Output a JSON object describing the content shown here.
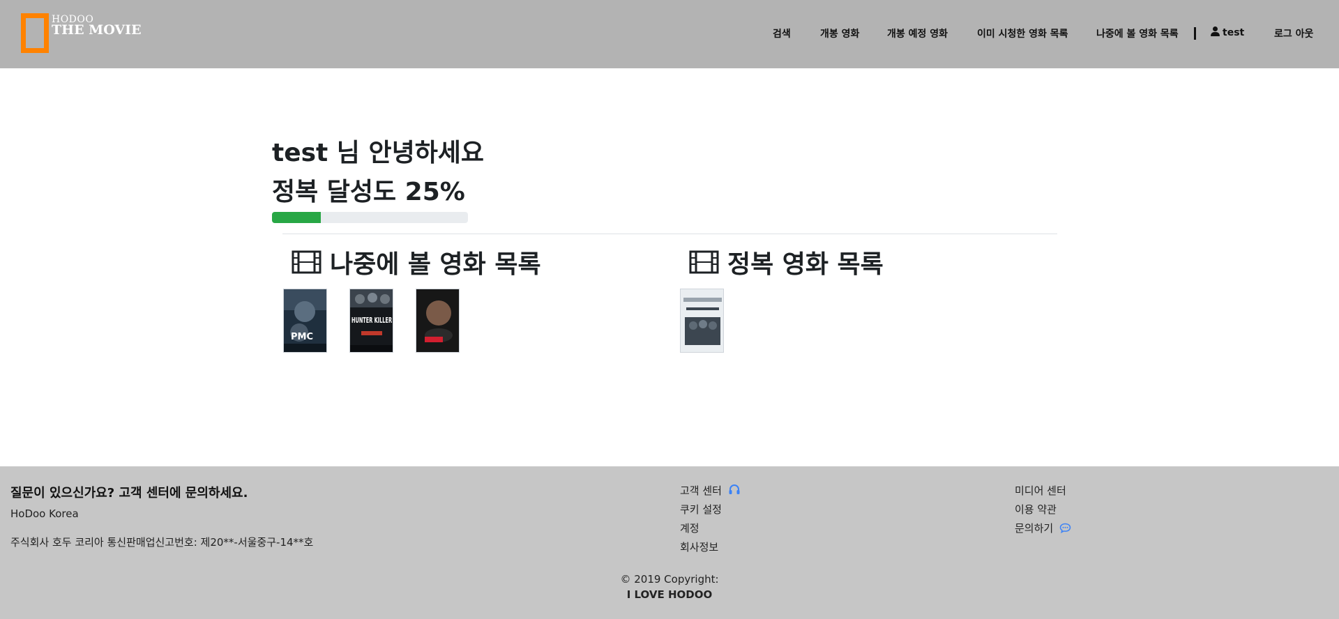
{
  "header": {
    "logo_small": "HODOO",
    "logo_big": "THE MOVIE",
    "nav": {
      "search": "검색",
      "released": "개봉 영화",
      "upcoming": "개봉 예정 영화",
      "watched": "이미 시청한 영화 목록",
      "watch_later": "나중에 볼 영화 목록",
      "user": "test",
      "logout": "로그 아웃"
    },
    "colors": {
      "background": "#b3b3b3",
      "logo_frame": "#ff8200"
    }
  },
  "main": {
    "greeting": "test 님 안녕하세요",
    "achievement": "정복 달성도 25%",
    "progress": {
      "value": 0.25,
      "color": "#28a745"
    },
    "watch_later_title": "나중에 볼 영화 목록",
    "conquered_title": "정복 영화 목록",
    "watch_later_posters": [
      {
        "text": "PMC",
        "icon": "movie-poster"
      },
      {
        "text": "HUNTER KILLER",
        "icon": "movie-poster"
      },
      {
        "text": "",
        "icon": "movie-poster"
      }
    ],
    "conquered_posters": [
      {
        "text": "",
        "icon": "movie-poster"
      }
    ]
  },
  "footer": {
    "heading": "질문이 있으신가요? 고객 센터에 문의하세요.",
    "company": "HoDoo Korea",
    "registration": "주식회사 호두 코리아 통신판매업신고번호: 제20**-서울중구-14**호",
    "links_col1": [
      "고객 센터",
      "쿠키 설정",
      "계정",
      "회사정보"
    ],
    "links_col2": [
      "미디어 센터",
      "이용 약관",
      "문의하기"
    ],
    "copyright": "© 2019 Copyright:",
    "brand": "I LOVE HODOO",
    "colors": {
      "background": "#c6c6c6",
      "icon": "#3b82f6"
    },
    "icons": {
      "support": "headset-icon",
      "inquiry": "chat-bubble-icon"
    }
  }
}
